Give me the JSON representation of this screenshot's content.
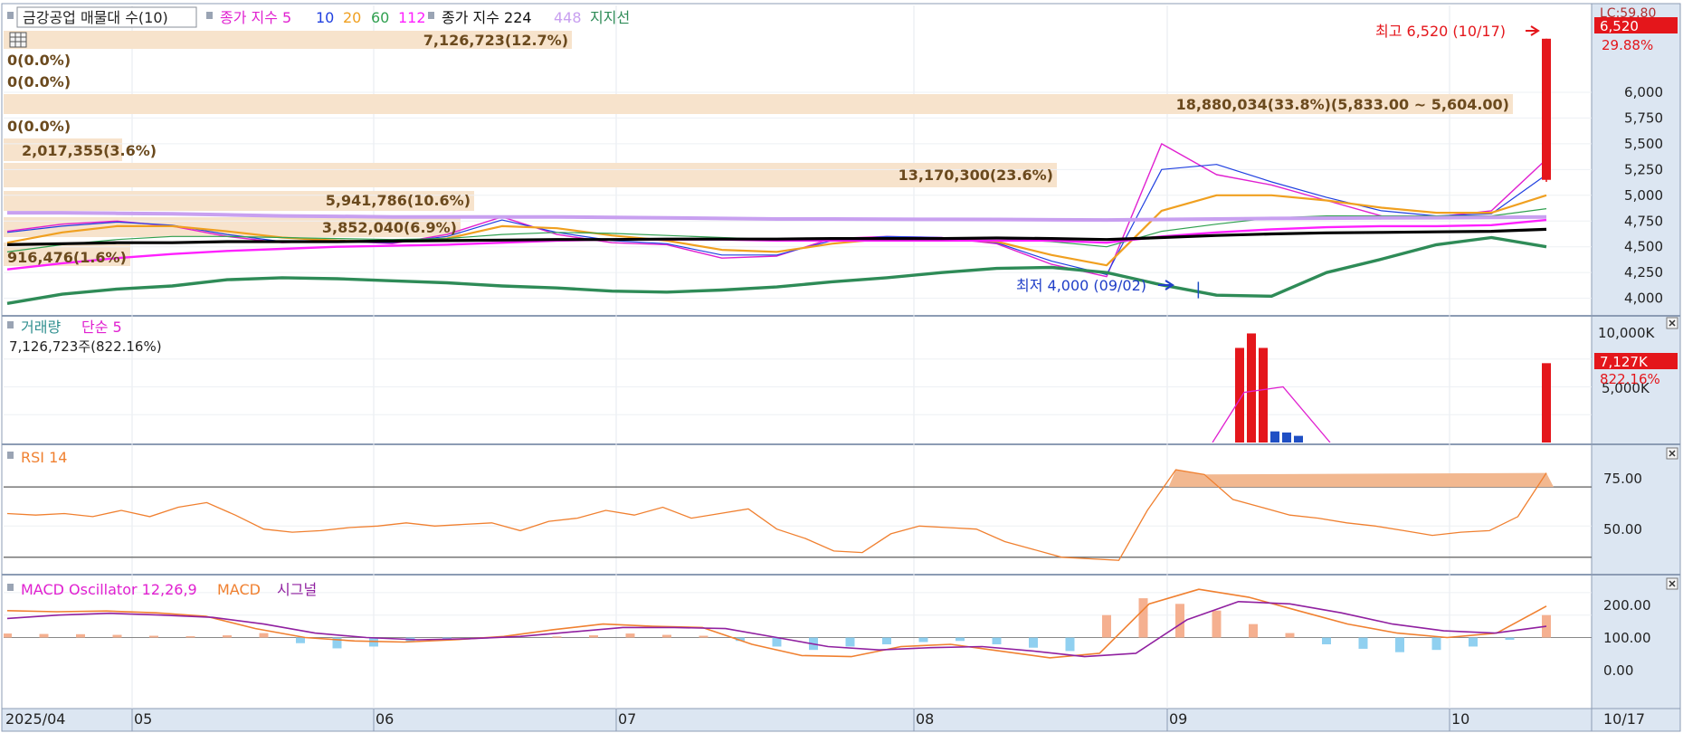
{
  "colors": {
    "up": "#e4161b",
    "down": "#1f4fc4",
    "ema5": "#e020d0",
    "ema10": "#2040e0",
    "ema20": "#f0a020",
    "ema60": "#30a050",
    "ema112": "#ff20ff",
    "ema224": "#000000",
    "ema448": "#c8a0f0",
    "support": "#2e8b57",
    "rsi": "#f08030",
    "macd": "#f08030",
    "signal": "#9020a0",
    "osc_pos": "#f5b090",
    "osc_neg": "#90d0f0",
    "band": "#f7e3cc",
    "axis_bg": "#dce6f2"
  },
  "header": {
    "stock_label": "금강공업 매물대 수(10)",
    "ema_label_a": "종가 지수 5",
    "ema_label_10": "10",
    "ema_label_20": "20",
    "ema_label_60": "60",
    "ema_label_112": "112",
    "ema_label_b": "종가 지수 224",
    "ema_label_448": "448",
    "support_label": "지지선",
    "right_tag": "LC:59.80"
  },
  "annotations": {
    "high_text": "최고 6,520 (10/17)",
    "low_text": "최저 4,000 (09/02)",
    "price_tag": "6,520",
    "price_pct": "29.88%"
  },
  "volume_profile": [
    {
      "text": "7,126,723(12.7%)"
    },
    {
      "text": "0(0.0%)"
    },
    {
      "text": "0(0.0%)"
    },
    {
      "text": "18,880,034(33.8%)(5,833.00 ~ 5,604.00)"
    },
    {
      "text": "0(0.0%)"
    },
    {
      "text": "2,017,355(3.6%)"
    },
    {
      "text": "13,170,300(23.6%)"
    },
    {
      "text": "5,941,786(10.6%)"
    },
    {
      "text": "3,852,040(6.9%)"
    },
    {
      "text": "916,476(1.6%)"
    }
  ],
  "price_axis": [
    "6,000",
    "5,750",
    "5,500",
    "5,250",
    "5,000",
    "4,750",
    "4,500",
    "4,250",
    "4,000"
  ],
  "volume_panel": {
    "title": "거래량",
    "ma_label": "단순 5",
    "info": "7,126,723주(822.16%)",
    "axis_top": "10,000K",
    "axis_mid": "5,000K",
    "tag": "7,127K",
    "tag_pct": "822.16%"
  },
  "rsi_panel": {
    "title": "RSI 14",
    "axis": [
      "75.00",
      "50.00"
    ]
  },
  "macd_panel": {
    "title": "MACD Oscillator 12,26,9",
    "macd_label": "MACD",
    "signal_label": "시그널",
    "axis": [
      "200.00",
      "100.00",
      "0.00"
    ]
  },
  "date_axis": {
    "labels": [
      "2025/04",
      "05",
      "06",
      "07",
      "08",
      "09",
      "10"
    ],
    "end_label": "10/17"
  },
  "chart_data": [
    {
      "type": "candlestick",
      "title": "금강공업",
      "x_start": "2025-04-01",
      "x_end": "2025-10-17",
      "ylim": [
        3900,
        6650
      ],
      "key_candles": [
        {
          "date": "2025-09-02",
          "low": 4000
        },
        {
          "date": "2025-10-17",
          "open": 5150,
          "high": 6520,
          "close": 6520
        }
      ],
      "series": [
        {
          "name": "5",
          "values": [
            4650,
            4720,
            4750,
            4700,
            4600,
            4540,
            4560,
            4530,
            4620,
            4790,
            4620,
            4540,
            4520,
            4390,
            4410,
            4580,
            4600,
            4590,
            4530,
            4330,
            4210,
            5500,
            5200,
            5100,
            4950,
            4800,
            4790,
            4850,
            5350
          ]
        },
        {
          "name": "10",
          "values": [
            4640,
            4700,
            4740,
            4710,
            4620,
            4550,
            4550,
            4540,
            4600,
            4760,
            4640,
            4560,
            4530,
            4420,
            4420,
            4560,
            4600,
            4590,
            4540,
            4360,
            4230,
            5250,
            5300,
            5130,
            4980,
            4850,
            4800,
            4820,
            5200
          ]
        },
        {
          "name": "20",
          "values": [
            4540,
            4640,
            4700,
            4700,
            4650,
            4590,
            4560,
            4550,
            4580,
            4700,
            4680,
            4610,
            4560,
            4470,
            4450,
            4530,
            4580,
            4580,
            4550,
            4420,
            4320,
            4850,
            5000,
            5000,
            4950,
            4880,
            4830,
            4830,
            5000
          ]
        },
        {
          "name": "60",
          "values": [
            4450,
            4520,
            4570,
            4600,
            4600,
            4590,
            4580,
            4570,
            4580,
            4620,
            4640,
            4630,
            4610,
            4590,
            4570,
            4570,
            4570,
            4580,
            4580,
            4550,
            4500,
            4650,
            4720,
            4780,
            4800,
            4800,
            4800,
            4800,
            4870
          ]
        },
        {
          "name": "112",
          "values": [
            4280,
            4340,
            4390,
            4430,
            4460,
            4480,
            4500,
            4510,
            4520,
            4540,
            4560,
            4570,
            4570,
            4570,
            4560,
            4560,
            4560,
            4560,
            4560,
            4560,
            4540,
            4600,
            4640,
            4670,
            4690,
            4700,
            4700,
            4710,
            4760
          ]
        },
        {
          "name": "224",
          "values": [
            4520,
            4530,
            4540,
            4540,
            4550,
            4550,
            4550,
            4555,
            4560,
            4565,
            4570,
            4570,
            4575,
            4575,
            4575,
            4580,
            4580,
            4580,
            4585,
            4580,
            4570,
            4590,
            4610,
            4625,
            4635,
            4640,
            4645,
            4650,
            4670
          ]
        },
        {
          "name": "448",
          "values": [
            4830,
            4830,
            4825,
            4820,
            4810,
            4800,
            4795,
            4790,
            4790,
            4790,
            4790,
            4785,
            4780,
            4775,
            4770,
            4770,
            4768,
            4766,
            4765,
            4762,
            4760,
            4765,
            4770,
            4775,
            4778,
            4780,
            4782,
            4785,
            4790
          ]
        },
        {
          "name": "지지선",
          "values": [
            3950,
            4040,
            4090,
            4120,
            4180,
            4200,
            4190,
            4170,
            4150,
            4120,
            4100,
            4070,
            4060,
            4080,
            4110,
            4160,
            4200,
            4250,
            4290,
            4300,
            4250,
            4130,
            4030,
            4020,
            4250,
            4380,
            4520,
            4590,
            4500
          ]
        }
      ]
    },
    {
      "type": "bar",
      "title": "거래량",
      "unit": "K",
      "ylim": [
        0,
        10000
      ],
      "last_value": 7127,
      "last_pct": 822.16,
      "peak_values": [
        8500,
        9800,
        8500,
        1000,
        900,
        600
      ],
      "ma5_peak": 5000
    },
    {
      "type": "line",
      "title": "RSI 14",
      "ylim": [
        20,
        100
      ],
      "values": [
        58,
        57,
        58,
        56,
        60,
        56,
        62,
        65,
        57,
        48,
        46,
        47,
        49,
        50,
        52,
        50,
        51,
        52,
        47,
        53,
        55,
        60,
        57,
        62,
        55,
        58,
        61,
        48,
        42,
        34,
        33,
        45,
        50,
        49,
        48,
        40,
        35,
        30,
        29,
        28,
        60,
        86,
        83,
        67,
        62,
        57,
        55,
        52,
        50,
        47,
        44,
        46,
        47,
        56,
        84
      ]
    },
    {
      "type": "bar",
      "title": "MACD Oscillator 12,26,9",
      "ylim": [
        -300,
        260
      ],
      "oscillator": [
        18,
        16,
        15,
        12,
        8,
        6,
        10,
        20,
        -25,
        -48,
        -40,
        -20,
        -10,
        -5,
        0,
        5,
        10,
        18,
        12,
        8,
        -15,
        -40,
        -55,
        -40,
        -30,
        -20,
        -15,
        -30,
        -45,
        -60,
        100,
        175,
        150,
        120,
        60,
        20,
        -30,
        -50,
        -65,
        -55,
        -40,
        -10,
        100
      ],
      "macd": [
        120,
        115,
        118,
        110,
        95,
        40,
        0,
        -15,
        -20,
        -10,
        5,
        35,
        60,
        50,
        45,
        -30,
        -80,
        -85,
        -40,
        -30,
        -60,
        -90,
        -70,
        150,
        215,
        180,
        120,
        60,
        20,
        0,
        20,
        140
      ],
      "signal": [
        85,
        100,
        108,
        100,
        90,
        60,
        20,
        0,
        -10,
        -5,
        5,
        25,
        45,
        45,
        40,
        0,
        -40,
        -55,
        -45,
        -40,
        -60,
        -85,
        -70,
        80,
        160,
        150,
        110,
        60,
        30,
        20,
        50
      ]
    }
  ]
}
